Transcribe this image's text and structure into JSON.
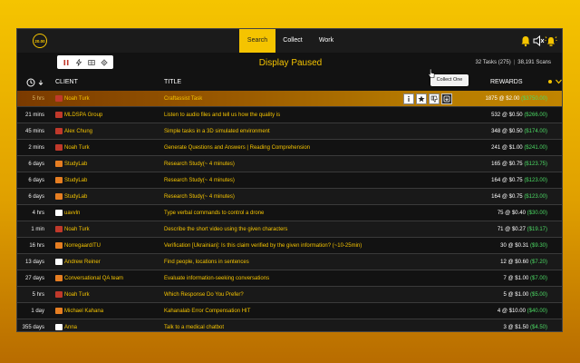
{
  "logo": "20.00",
  "nav": {
    "search": "Search",
    "collect": "Collect",
    "work": "Work"
  },
  "display_status": "Display Paused",
  "stats": {
    "tasks": "32 Tasks (275)",
    "scans": "38,191 Scans"
  },
  "columns": {
    "client": "CLIENT",
    "title": "TITLE",
    "rewards": "REWARDS"
  },
  "tooltip": "Collect One",
  "colors": {
    "accent": "#f5c400",
    "reward_green": "#4cd964",
    "icon_red": "#c0392b",
    "icon_orange": "#e67e22",
    "icon_white": "#ffffff"
  },
  "rows": [
    {
      "age": "5 hrs",
      "icon": "red",
      "client": "Noah Turk",
      "title": "Craftassist Task",
      "qty": "1875",
      "price": "$2.00",
      "total": "($3750.00)"
    },
    {
      "age": "21 mins",
      "icon": "red",
      "client": "MLDSPA Group",
      "title": "Listen to audio files and tell us how the quality is",
      "qty": "532",
      "price": "$0.50",
      "total": "($266.00)"
    },
    {
      "age": "45 mins",
      "icon": "red",
      "client": "Alex Chung",
      "title": "Simple tasks in a 3D simulated environment",
      "qty": "348",
      "price": "$0.50",
      "total": "($174.00)"
    },
    {
      "age": "2 mins",
      "icon": "red",
      "client": "Noah Turk",
      "title": "Generate Questions and Answers | Reading Comprehension",
      "qty": "241",
      "price": "$1.00",
      "total": "($241.00)"
    },
    {
      "age": "6 days",
      "icon": "orange",
      "client": "StudyLab",
      "title": "Research Study(~ 4 minutes)",
      "qty": "165",
      "price": "$0.75",
      "total": "($123.75)"
    },
    {
      "age": "6 days",
      "icon": "orange",
      "client": "StudyLab",
      "title": "Research Study(~ 4 minutes)",
      "qty": "164",
      "price": "$0.75",
      "total": "($123.00)"
    },
    {
      "age": "6 days",
      "icon": "orange",
      "client": "StudyLab",
      "title": "Research Study(~ 4 minutes)",
      "qty": "164",
      "price": "$0.75",
      "total": "($123.00)"
    },
    {
      "age": "4 hrs",
      "icon": "white",
      "client": "uavvln",
      "title": "Type verbal commands to control a drone",
      "qty": "75",
      "price": "$0.40",
      "total": "($30.00)"
    },
    {
      "age": "1 min",
      "icon": "red",
      "client": "Noah Turk",
      "title": "Describe the short video using the given characters",
      "qty": "71",
      "price": "$0.27",
      "total": "($19.17)"
    },
    {
      "age": "16 hrs",
      "icon": "orange",
      "client": "NorregaardITU",
      "title": "Verification [Ukrainian]: Is this claim verified by the given information? (~10-25min)",
      "qty": "30",
      "price": "$0.31",
      "total": "($9.30)"
    },
    {
      "age": "13 days",
      "icon": "white",
      "client": "Andrew Reiner",
      "title": "Find people, locations in sentences",
      "qty": "12",
      "price": "$0.60",
      "total": "($7.20)"
    },
    {
      "age": "27 days",
      "icon": "orange",
      "client": "Conversational QA team",
      "title": "Evaluate information-seeking conversations",
      "qty": "7",
      "price": "$1.00",
      "total": "($7.00)"
    },
    {
      "age": "5 hrs",
      "icon": "red",
      "client": "Noah Turk",
      "title": "Which Response Do You Prefer?",
      "qty": "5",
      "price": "$1.00",
      "total": "($5.00)"
    },
    {
      "age": "1 day",
      "icon": "orange",
      "client": "Michael Kahana",
      "title": "Kahanalab Error Compensation HIT",
      "qty": "4",
      "price": "$10.00",
      "total": "($40.00)"
    },
    {
      "age": "355 days",
      "icon": "white",
      "client": "Anna",
      "title": "Talk to a medical chatbot",
      "qty": "3",
      "price": "$1.50",
      "total": "($4.50)"
    }
  ]
}
